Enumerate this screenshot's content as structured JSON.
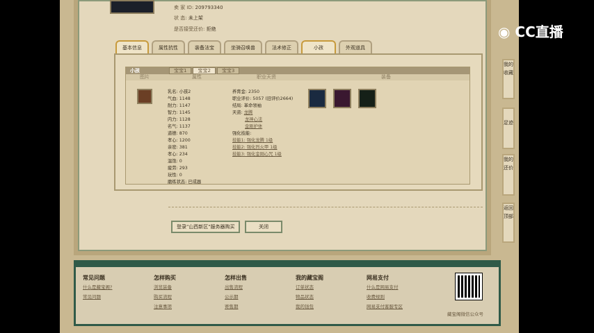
{
  "seller": {
    "id_label": "卖 家 ID:",
    "id": "209793340",
    "status_label": "状 态:",
    "status": "未上架",
    "bargain_label": "是否接受还价:",
    "bargain": "拒绝"
  },
  "tabs": [
    "基本信息",
    "属性抗性",
    "装备法宝",
    "坐骑召唤兽",
    "法术修正",
    "小孩",
    "外观道具"
  ],
  "panel": {
    "title": "小孩",
    "subtabs": [
      "宝宝1",
      "宝宝2",
      "宝宝3"
    ],
    "headers": [
      "图片",
      "属性",
      "职业天资",
      "装备"
    ]
  },
  "attrs": [
    "乳名: 小孩2",
    "气血: 1148",
    "耐力: 1147",
    "智力: 1145",
    "内力: 1128",
    "名气: 1137",
    "道德: 870",
    "孝心: 1200",
    "亲密: 381",
    "孝心: 234",
    "温饱: 0",
    "疲劳: 293",
    "玩性: 0",
    "磨练状态: 已成器"
  ],
  "career": {
    "money": "养育金: 2350",
    "score": "职业评价: 5057 (旧评价2664)",
    "ending": "结局: 革命领袖",
    "talent_label": "天资:",
    "talents": [
      "龙腾",
      "龙神心法",
      "金刚护体"
    ],
    "skill_label": "强化技能:",
    "skills": [
      "技能1: 强化龙腾 1级",
      "技能2: 强化烈火甲 1级",
      "技能3: 强化金刚心咒 1级"
    ]
  },
  "buttons": {
    "login": "登录\"山西新区\"服务器购买",
    "close": "关闭"
  },
  "footer": [
    {
      "h": "常见问题",
      "links": [
        "什么是藏宝阁?",
        "常见问题"
      ]
    },
    {
      "h": "怎样购买",
      "links": [
        "浏览装备",
        "购买流程",
        "注意事项"
      ]
    },
    {
      "h": "怎样出售",
      "links": [
        "出售流程",
        "公示期",
        "寄售期"
      ]
    },
    {
      "h": "我的藏宝阁",
      "links": [
        "订单状态",
        "物品状态",
        "我的钱包"
      ]
    },
    {
      "h": "网易支付",
      "links": [
        "什么是网易支付",
        "收费规则",
        "网易支付客服专区"
      ]
    }
  ],
  "qr_caption": "藏宝阁微信公众号",
  "side": [
    "我的收藏",
    "足迹",
    "我的还价",
    "返回顶部"
  ],
  "logo": "CC直播"
}
